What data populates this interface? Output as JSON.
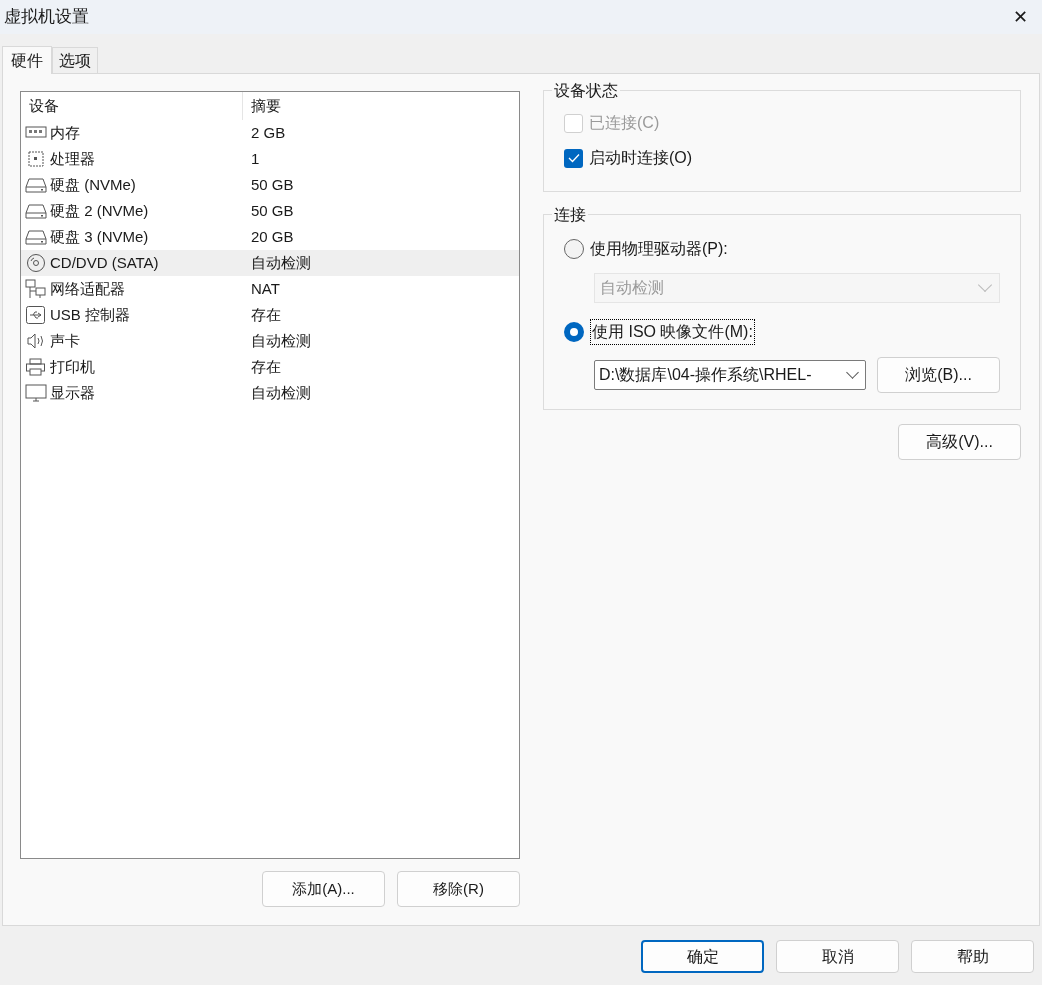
{
  "window": {
    "title": "虚拟机设置",
    "close": "✕"
  },
  "tabs": [
    {
      "label": "硬件",
      "selected": true
    },
    {
      "label": "选项",
      "selected": false
    }
  ],
  "device_list": {
    "columns": [
      "设备",
      "摘要"
    ],
    "rows": [
      {
        "kind": "memory",
        "device": "内存",
        "summary": "2 GB",
        "selected": false
      },
      {
        "kind": "cpu",
        "device": "处理器",
        "summary": "1",
        "selected": false
      },
      {
        "kind": "disk",
        "device": "硬盘 (NVMe)",
        "summary": "50 GB",
        "selected": false
      },
      {
        "kind": "disk",
        "device": "硬盘 2 (NVMe)",
        "summary": "50 GB",
        "selected": false
      },
      {
        "kind": "disk",
        "device": "硬盘 3 (NVMe)",
        "summary": "20 GB",
        "selected": false
      },
      {
        "kind": "cd",
        "device": "CD/DVD (SATA)",
        "summary": "自动检测",
        "selected": true
      },
      {
        "kind": "network",
        "device": "网络适配器",
        "summary": "NAT",
        "selected": false
      },
      {
        "kind": "usb",
        "device": "USB 控制器",
        "summary": "存在",
        "selected": false
      },
      {
        "kind": "sound",
        "device": "声卡",
        "summary": "自动检测",
        "selected": false
      },
      {
        "kind": "printer",
        "device": "打印机",
        "summary": "存在",
        "selected": false
      },
      {
        "kind": "display",
        "device": "显示器",
        "summary": "自动检测",
        "selected": false
      }
    ]
  },
  "list_buttons": [
    "添加(A)...",
    "移除(R)"
  ],
  "device_status": {
    "title": "设备状态",
    "options": [
      {
        "label": "已连接(C)",
        "checked": false,
        "disabled": true
      },
      {
        "label": "启动时连接(O)",
        "checked": true,
        "disabled": false
      }
    ]
  },
  "connection": {
    "title": "连接",
    "physical": {
      "label": "使用物理驱动器(P):",
      "selected": false,
      "dropdown": "自动检测"
    },
    "iso": {
      "label": "使用 ISO 映像文件(M):",
      "selected": true,
      "path": "D:\\数据库\\04-操作系统\\RHEL-",
      "browse": "浏览(B)..."
    }
  },
  "advanced_button": "高级(V)...",
  "footer_buttons": [
    {
      "label": "确定",
      "default": true
    },
    {
      "label": "取消",
      "default": false
    },
    {
      "label": "帮助",
      "default": false
    }
  ]
}
